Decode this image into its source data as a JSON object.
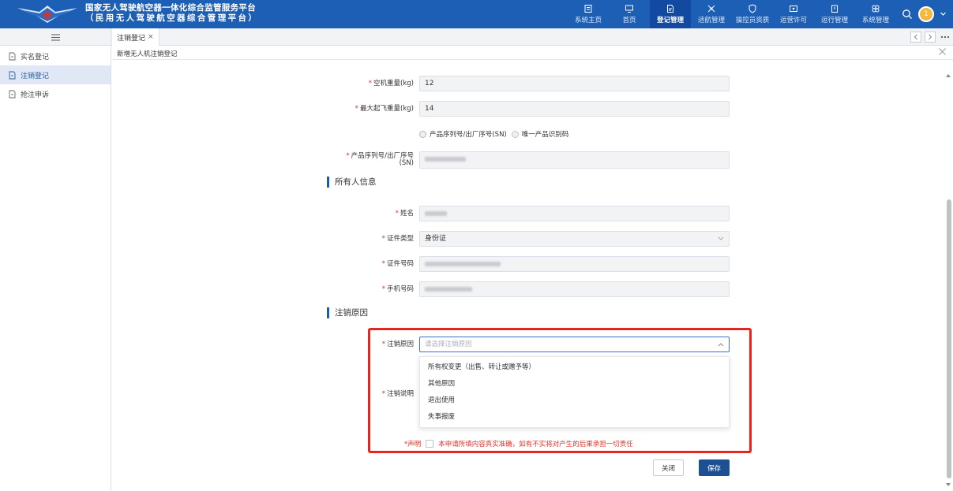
{
  "header": {
    "title_line1": "国家无人驾驶航空器一体化综合监管服务平台",
    "title_line2": "（民用无人驾驶航空器综合管理平台）",
    "nav": [
      {
        "label": "系统主页",
        "icon": "monitor-icon"
      },
      {
        "label": "首页",
        "icon": "desktop-icon"
      },
      {
        "label": "登记管理",
        "icon": "document-icon",
        "active": true
      },
      {
        "label": "适航管理",
        "icon": "drone-icon"
      },
      {
        "label": "操控员资质",
        "icon": "shield-icon"
      },
      {
        "label": "运营许可",
        "icon": "license-icon"
      },
      {
        "label": "运行管理",
        "icon": "clipboard-icon"
      },
      {
        "label": "系统管理",
        "icon": "settings-icon"
      }
    ],
    "notification_count": "1"
  },
  "tabs": [
    {
      "label": "注销登记",
      "close": "×"
    }
  ],
  "sidebar": {
    "items": [
      {
        "label": "实名登记"
      },
      {
        "label": "注销登记",
        "active": true
      },
      {
        "label": "抢注申诉"
      }
    ]
  },
  "page": {
    "title": "新增无人机注销登记"
  },
  "form": {
    "empty_weight": {
      "label": "空机重量(kg)",
      "value": "12"
    },
    "max_takeoff_weight": {
      "label": "最大起飞重量(kg)",
      "value": "14"
    },
    "id_type_options": [
      "产品序列号/出厂序号(SN)",
      "唯一产品识别码"
    ],
    "serial_number": {
      "label_line1": "产品序列号/出厂序号",
      "label_line2": "(SN)"
    },
    "owner_section": "所有人信息",
    "name": {
      "label": "姓名"
    },
    "cert_type": {
      "label": "证件类型",
      "value": "身份证"
    },
    "cert_number": {
      "label": "证件号码"
    },
    "phone": {
      "label": "手机号码"
    },
    "reason_section": "注销原因",
    "reason": {
      "label": "注销原因",
      "placeholder": "请选择注销原因",
      "options": [
        "所有权变更（出售、转让或赠予等）",
        "其他原因",
        "退出使用",
        "失事报废"
      ]
    },
    "description": {
      "label": "注销说明"
    },
    "declaration": {
      "label": "*声明",
      "text": "本申请所填内容真实准确，如有不实将对产生的后果承担一切责任"
    }
  },
  "buttons": {
    "close": "关闭",
    "save": "保存"
  },
  "colors": {
    "header": "#1d5fb4",
    "accent": "#1d4f93",
    "required": "#e3322b",
    "highlight": "#e7241d"
  }
}
